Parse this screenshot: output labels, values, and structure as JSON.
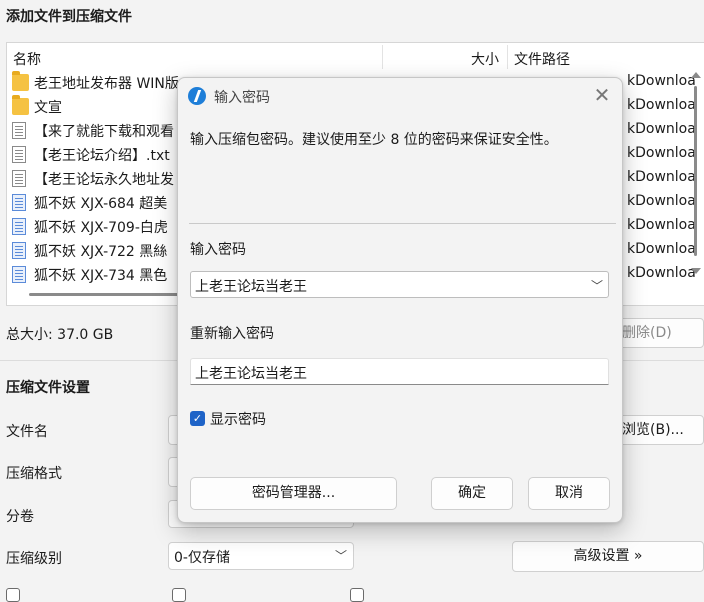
{
  "background_window": {
    "title": "添加文件到压缩文件",
    "columns": {
      "name": "名称",
      "size": "大小",
      "path": "文件路径"
    },
    "files": [
      {
        "name": "老王地址发布器 WIN版",
        "path": "kDownloa",
        "icon": "folder-icon"
      },
      {
        "name": "文宣",
        "path": "kDownloa",
        "icon": "folder-icon"
      },
      {
        "name": "【来了就能下载和观看",
        "path": "kDownloa",
        "icon": "doc-icon"
      },
      {
        "name": "【老王论坛介绍】.txt",
        "path": "kDownloa",
        "icon": "doc-icon"
      },
      {
        "name": "【老王论坛永久地址发",
        "path": "kDownloa",
        "icon": "doc-icon"
      },
      {
        "name": "狐不妖 XJX-684 超美",
        "path": "kDownloa",
        "icon": "video-file-icon"
      },
      {
        "name": "狐不妖 XJX-709-白虎",
        "path": "kDownloa",
        "icon": "video-file-icon"
      },
      {
        "name": "狐不妖 XJX-722 黑絲",
        "path": "kDownloa",
        "icon": "video-file-icon"
      },
      {
        "name": "狐不妖 XJX-734 黑色",
        "path": "kDownloa",
        "icon": "video-file-icon"
      }
    ],
    "total_size": "总大小: 37.0 GB",
    "delete_button": "删除(D)",
    "settings_heading": "压缩文件设置",
    "filename_label": "文件名",
    "browse_button": "浏览(B)...",
    "format_label": "压缩格式",
    "split_label": "分卷",
    "level_label": "压缩级别",
    "level_value": "0-仅存储",
    "advanced_button": "高级设置 »"
  },
  "dialog": {
    "title": "输入密码",
    "description": "输入压缩包密码。建议使用至少 8 位的密码来保证安全性。",
    "password_label": "输入密码",
    "password_value": "上老王论坛当老王",
    "confirm_label": "重新输入密码",
    "confirm_value": "上老王论坛当老王",
    "show_password_label": "显示密码",
    "show_password_checked": true,
    "manager_button": "密码管理器...",
    "ok_button": "确定",
    "cancel_button": "取消",
    "accent_color": "#1e63c7"
  }
}
